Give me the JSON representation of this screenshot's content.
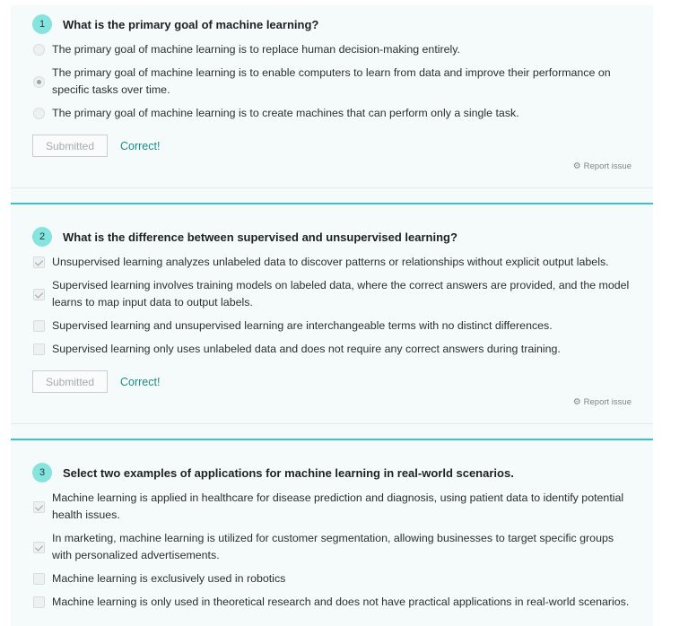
{
  "questions": [
    {
      "number": "1",
      "title": "What is the primary goal of machine learning?",
      "type": "radio",
      "options": [
        {
          "text": "The primary goal of machine learning is to replace human decision-making entirely.",
          "checked": false
        },
        {
          "text": "The primary goal of machine learning is to enable computers to learn from data and improve their performance on specific tasks over time.",
          "checked": true
        },
        {
          "text": "The primary goal of machine learning is to create machines that can perform only a single task.",
          "checked": false
        }
      ],
      "button_label": "Submitted",
      "result": "Correct!",
      "report_label": "Report issue"
    },
    {
      "number": "2",
      "title": "What is the difference between supervised and unsupervised learning?",
      "type": "checkbox",
      "options": [
        {
          "text": "Unsupervised learning analyzes unlabeled data to discover patterns or relationships without explicit output labels.",
          "checked": true
        },
        {
          "text": "Supervised learning involves training models on labeled data, where the correct answers are provided, and the model learns to map input data to output labels.",
          "checked": true
        },
        {
          "text": "Supervised learning and unsupervised learning are interchangeable terms with no distinct differences.",
          "checked": false
        },
        {
          "text": "Supervised learning only uses unlabeled data and does not require any correct answers during training.",
          "checked": false
        }
      ],
      "button_label": "Submitted",
      "result": "Correct!",
      "report_label": "Report issue"
    },
    {
      "number": "3",
      "title": "Select two examples of applications for machine learning in real-world scenarios.",
      "type": "checkbox",
      "options": [
        {
          "text": "Machine learning is applied in healthcare for disease prediction and diagnosis, using patient data to identify potential health issues.",
          "checked": true
        },
        {
          "text": "In marketing, machine learning is utilized for customer segmentation, allowing businesses to target specific groups with personalized advertisements.",
          "checked": true
        },
        {
          "text": "Machine learning is exclusively used in robotics",
          "checked": false
        },
        {
          "text": "Machine learning is only used in theoretical research and does not have practical applications in real-world scenarios.",
          "checked": false
        }
      ]
    }
  ],
  "icons": {
    "report": "bug-icon"
  },
  "colors": {
    "accent": "#39c2cf",
    "badge": "#86e3dd",
    "correct": "#1a8c86"
  }
}
